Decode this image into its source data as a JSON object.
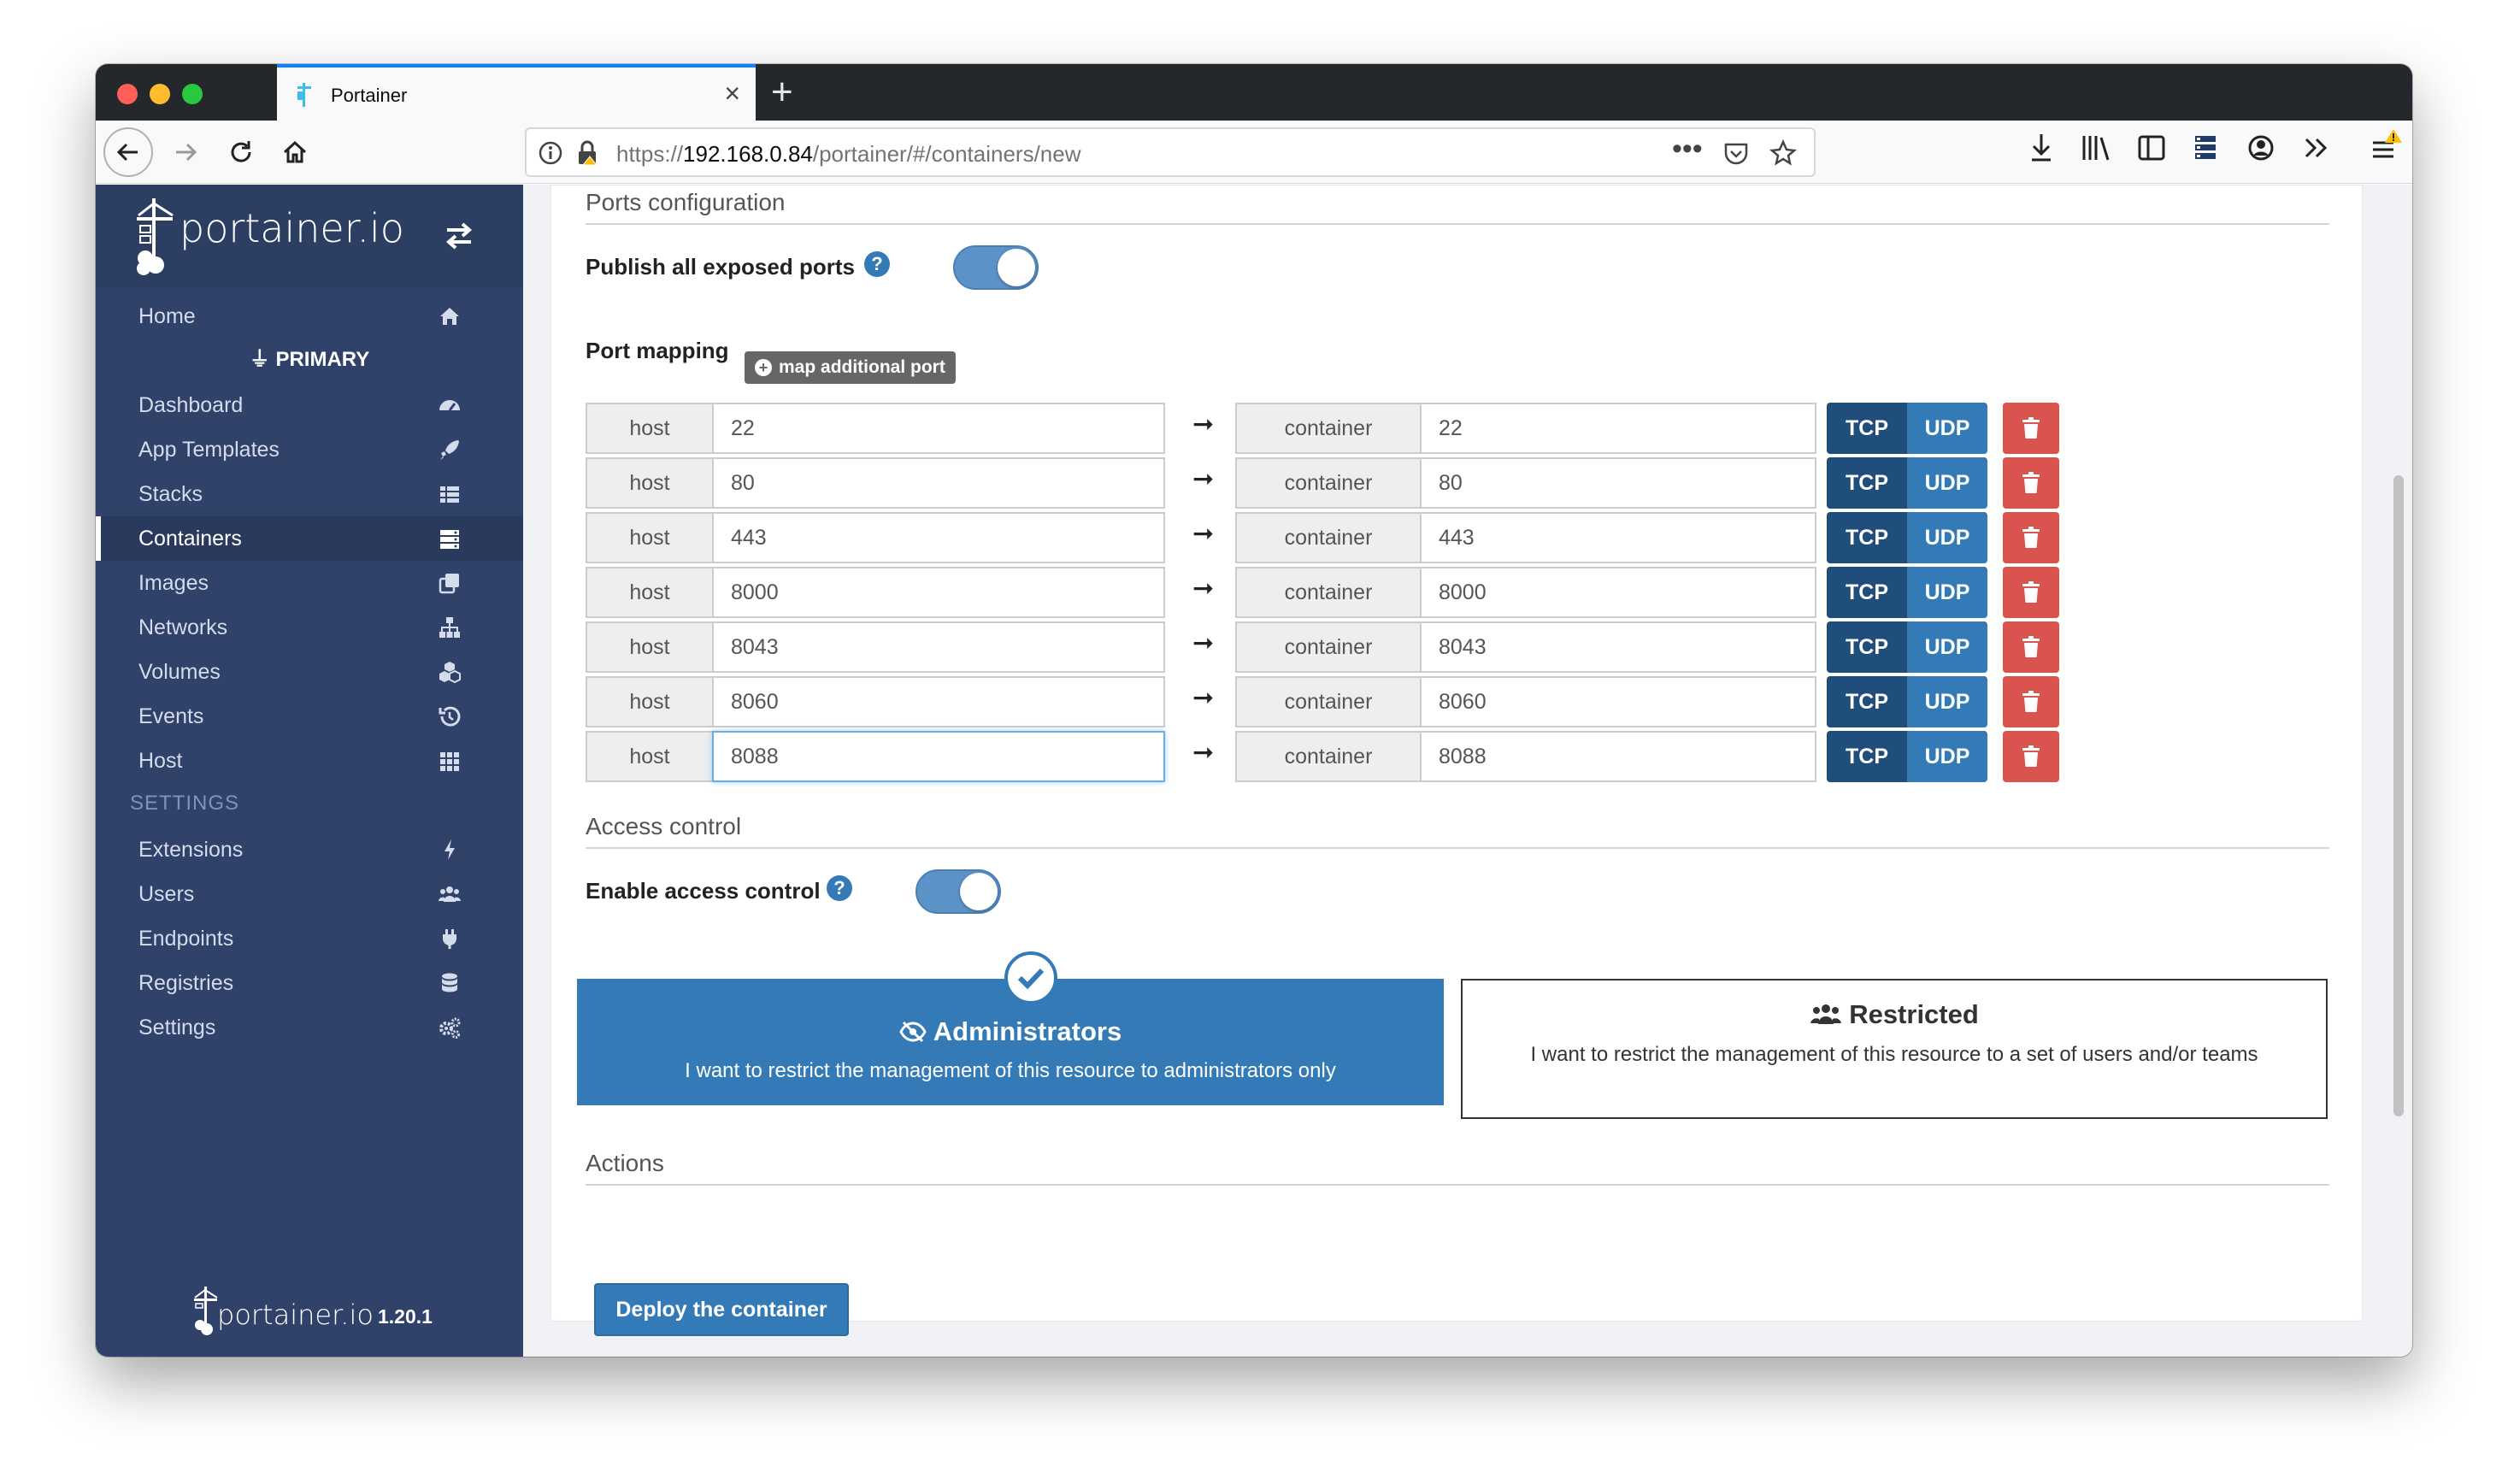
{
  "browser": {
    "tab_title": "Portainer",
    "url_prefix": "https://",
    "url_host": "192.168.0.84",
    "url_path": "/portainer/#/containers/new"
  },
  "sidebar": {
    "brand": "portainer.io",
    "endpoint": "PRIMARY",
    "settings_section": "SETTINGS",
    "items": [
      {
        "label": "Home",
        "icon": "home-icon"
      },
      {
        "label": "Dashboard",
        "icon": "tachometer-icon"
      },
      {
        "label": "App Templates",
        "icon": "rocket-icon"
      },
      {
        "label": "Stacks",
        "icon": "th-list-icon"
      },
      {
        "label": "Containers",
        "icon": "server-icon"
      },
      {
        "label": "Images",
        "icon": "clone-icon"
      },
      {
        "label": "Networks",
        "icon": "sitemap-icon"
      },
      {
        "label": "Volumes",
        "icon": "cubes-icon"
      },
      {
        "label": "Events",
        "icon": "history-icon"
      },
      {
        "label": "Host",
        "icon": "th-icon"
      }
    ],
    "settings_items": [
      {
        "label": "Extensions",
        "icon": "bolt-icon"
      },
      {
        "label": "Users",
        "icon": "users-icon"
      },
      {
        "label": "Endpoints",
        "icon": "plug-icon"
      },
      {
        "label": "Registries",
        "icon": "database-icon"
      },
      {
        "label": "Settings",
        "icon": "cogs-icon"
      }
    ],
    "footer_brand": "portainer.io",
    "version": "1.20.1"
  },
  "ports": {
    "section_title": "Ports configuration",
    "publish_label": "Publish all exposed ports",
    "publish_enabled": true,
    "mapping_label": "Port mapping",
    "map_button": "map additional port",
    "host_label": "host",
    "container_label": "container",
    "tcp_label": "TCP",
    "udp_label": "UDP",
    "rows": [
      {
        "host": "22",
        "container": "22"
      },
      {
        "host": "80",
        "container": "80"
      },
      {
        "host": "443",
        "container": "443"
      },
      {
        "host": "8000",
        "container": "8000"
      },
      {
        "host": "8043",
        "container": "8043"
      },
      {
        "host": "8060",
        "container": "8060"
      },
      {
        "host": "8088",
        "container": "8088"
      }
    ]
  },
  "access": {
    "section_title": "Access control",
    "enable_label": "Enable access control",
    "enabled": true,
    "admin_title": "Administrators",
    "admin_desc": "I want to restrict the management of this resource to administrators only",
    "restricted_title": "Restricted",
    "restricted_desc": "I want to restrict the management of this resource to a set of users and/or teams"
  },
  "actions": {
    "section_title": "Actions",
    "deploy_label": "Deploy the container"
  },
  "colors": {
    "sidebar": "#30426a",
    "primary": "#337ab7",
    "tcp_active": "#1e4e79",
    "danger": "#d9534f"
  }
}
